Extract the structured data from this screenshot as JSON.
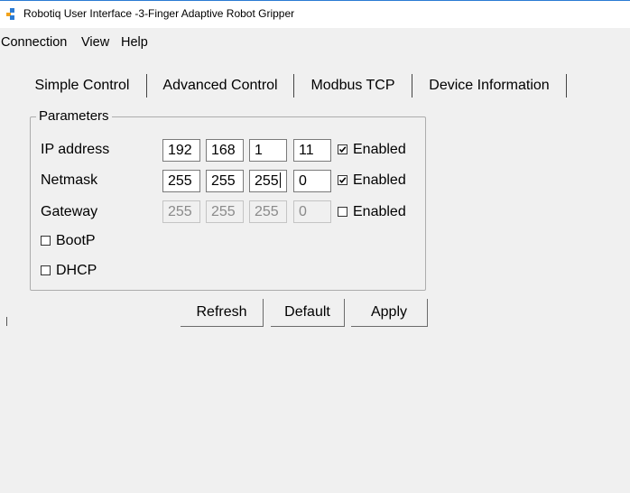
{
  "window": {
    "title": "Robotiq User Interface -3-Finger Adaptive Robot Gripper",
    "icon": "robotiq-logo-icon",
    "accent_color": "#2b7bd3"
  },
  "menu": {
    "items": [
      "Connection",
      "View",
      "Help"
    ]
  },
  "tabs": [
    {
      "label": "Simple Control",
      "active": false
    },
    {
      "label": "Advanced Control",
      "active": false
    },
    {
      "label": "Modbus TCP",
      "active": true
    },
    {
      "label": "Device Information",
      "active": false
    }
  ],
  "parameters": {
    "legend": "Parameters",
    "rows": [
      {
        "label": "IP address",
        "octets": [
          "192",
          "168",
          "1",
          "11"
        ],
        "enabled_label": "Enabled",
        "enabled": true,
        "disabled_fields": false
      },
      {
        "label": "Netmask",
        "octets": [
          "255",
          "255",
          "255",
          "0"
        ],
        "enabled_label": "Enabled",
        "enabled": true,
        "disabled_fields": false
      },
      {
        "label": "Gateway",
        "octets": [
          "255",
          "255",
          "255",
          "0"
        ],
        "enabled_label": "Enabled",
        "enabled": false,
        "disabled_fields": true
      }
    ],
    "bootp": {
      "label": "BootP",
      "checked": false
    },
    "dhcp": {
      "label": "DHCP",
      "checked": false
    }
  },
  "buttons": {
    "refresh": "Refresh",
    "default": "Default",
    "apply": "Apply"
  }
}
